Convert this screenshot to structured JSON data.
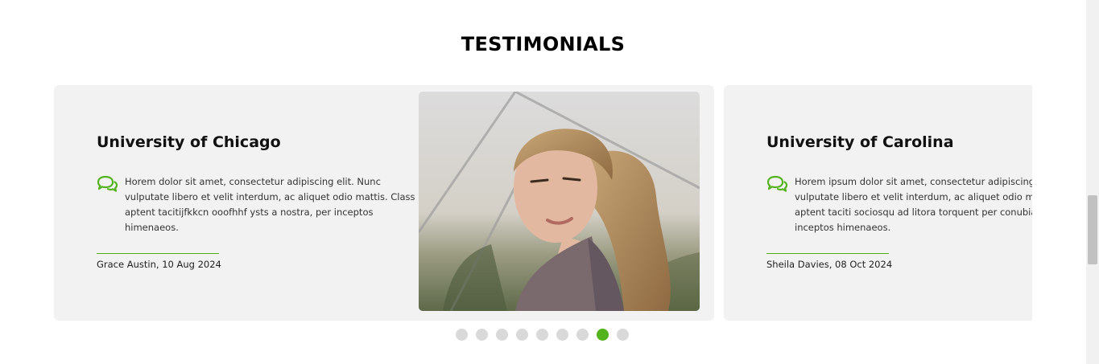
{
  "section": {
    "title": "TESTIMONIALS"
  },
  "testimonials": [
    {
      "title": "University of Chicago",
      "text": "Horem dolor sit amet, consectetur adipiscing elit. Nunc vulputate libero et velit interdum, ac aliquet odio mattis. Class aptent tacitijfkkcn ooofhhf ysts a nostra, per inceptos himenaeos.",
      "author": "Grace Austin, 10 Aug 2024"
    },
    {
      "title": "University of Carolina",
      "text": "Horem ipsum dolor sit amet, consectetur adipiscing elit. Nunc vulputate libero et velit interdum, ac aliquet odio mattis. Class aptent taciti sociosqu ad litora torquent per conubia nostra, per inceptos himenaeos.",
      "author": "Sheila Davies, 08 Oct 2024"
    }
  ],
  "carousel": {
    "dot_count": 9,
    "active_index": 7
  },
  "colors": {
    "accent": "#52b31d",
    "card_bg": "#f2f2f2",
    "dot_inactive": "#d9d9d9"
  },
  "icons": {
    "quote": "speech-bubbles-icon"
  }
}
